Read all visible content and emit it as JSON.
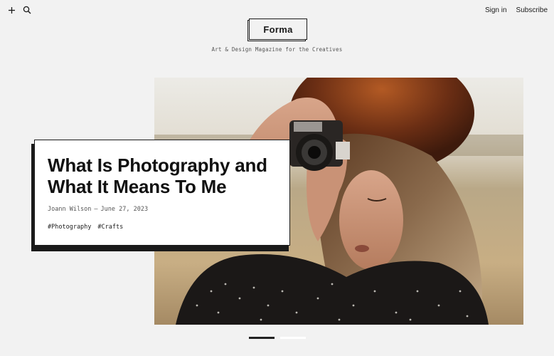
{
  "header": {
    "logo": "Forma",
    "tagline": "Art & Design Magazine for the Creatives",
    "icons": [
      "plus-icon",
      "search-icon"
    ],
    "nav": {
      "sign_in": "Sign in",
      "subscribe": "Subscribe"
    }
  },
  "featured": {
    "title_line1": "What Is Photography and",
    "title_line2": "What It Means To Me",
    "author": "Joann Wilson",
    "separator": "—",
    "date": "June 27, 2023",
    "tags": [
      "#Photography",
      "#Crafts"
    ]
  },
  "pagination": {
    "active_index": 0,
    "total": 2
  },
  "colors": {
    "background": "#f2f2f2",
    "ink": "#1a1a1a",
    "card": "#ffffff"
  }
}
